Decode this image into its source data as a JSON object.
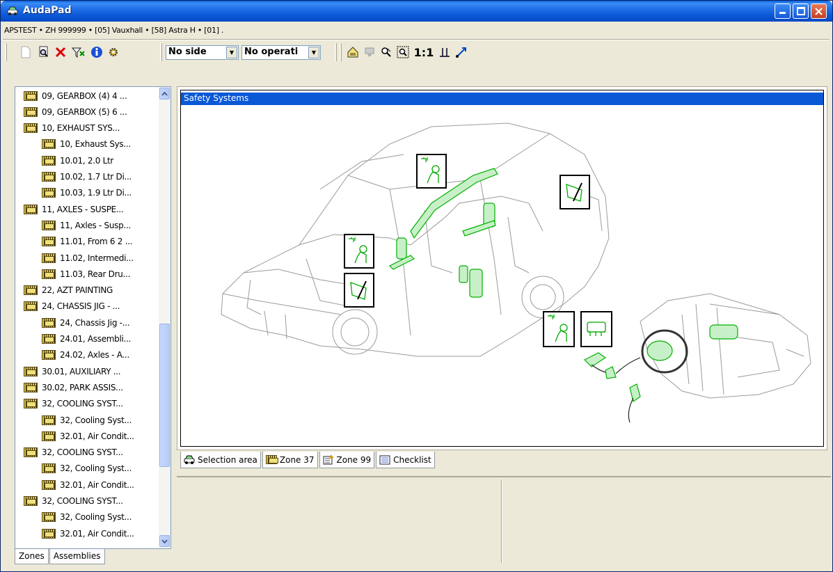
{
  "window": {
    "title": "AudaPad"
  },
  "path": "APSTEST • ZH 999999 • [05] Vauxhall • [58] Astra H • [01] .",
  "toolbar": {
    "side_combo": "No side",
    "operation_combo": "No operati",
    "zoom_label": "1:1"
  },
  "tree": {
    "items": [
      {
        "label": "09, GEARBOX (4) 4 ...",
        "level": 0
      },
      {
        "label": "09, GEARBOX (5) 6 ...",
        "level": 0
      },
      {
        "label": "10, EXHAUST SYS...",
        "level": 0
      },
      {
        "label": "10, Exhaust Sys...",
        "level": 1
      },
      {
        "label": "10.01, 2.0 Ltr",
        "level": 1
      },
      {
        "label": "10.02, 1.7 Ltr Di...",
        "level": 1
      },
      {
        "label": "10.03, 1.9 Ltr Di...",
        "level": 1
      },
      {
        "label": "11, AXLES - SUSPE...",
        "level": 0
      },
      {
        "label": "11, Axles - Susp...",
        "level": 1
      },
      {
        "label": "11.01, From 6 2 ...",
        "level": 1
      },
      {
        "label": "11.02, Intermedi...",
        "level": 1
      },
      {
        "label": "11.03, Rear Dru...",
        "level": 1
      },
      {
        "label": "22, AZT PAINTING",
        "level": 0
      },
      {
        "label": "24, CHASSIS JIG - ...",
        "level": 0
      },
      {
        "label": "24, Chassis Jig -...",
        "level": 1
      },
      {
        "label": "24.01, Assembli...",
        "level": 1
      },
      {
        "label": "24.02, Axles - A...",
        "level": 1
      },
      {
        "label": "30.01, AUXILIARY ...",
        "level": 0
      },
      {
        "label": "30.02, PARK ASSIS...",
        "level": 0
      },
      {
        "label": "32, COOLING SYST...",
        "level": 0
      },
      {
        "label": "32, Cooling Syst...",
        "level": 1
      },
      {
        "label": "32.01, Air Condit...",
        "level": 1
      },
      {
        "label": "32, COOLING SYST...",
        "level": 0
      },
      {
        "label": "32, Cooling Syst...",
        "level": 1
      },
      {
        "label": "32.01, Air Condit...",
        "level": 1
      },
      {
        "label": "32, COOLING SYST...",
        "level": 0
      },
      {
        "label": "32, Cooling Syst...",
        "level": 1
      },
      {
        "label": "32.01, Air Condit...",
        "level": 1
      }
    ]
  },
  "left_tabs": {
    "zones": "Zones",
    "assemblies": "Assemblies"
  },
  "viewport": {
    "header": "Safety Systems"
  },
  "bottom_tabs": {
    "selection": "Selection area",
    "zone37": "Zone 37",
    "zone99": "Zone 99",
    "checklist": "Checklist"
  },
  "colors": {
    "titlebar": "#0a58d6",
    "highlight": "#0a58d6",
    "part_green": "#00cc00"
  }
}
